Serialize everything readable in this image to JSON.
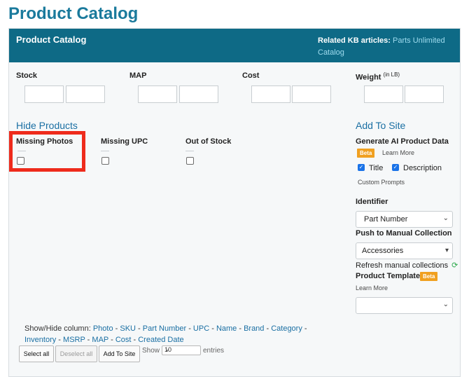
{
  "page_title": "Product Catalog",
  "panel": {
    "title": "Product Catalog",
    "kb_label": "Related KB articles:",
    "kb_link": "Parts Unlimited Catalog"
  },
  "filters": {
    "stock": "Stock",
    "map": "MAP",
    "cost": "Cost",
    "weight": "Weight",
    "weight_unit": "(in LB)"
  },
  "hide_products": {
    "title": "Hide Products",
    "missing_photos": "Missing Photos",
    "missing_upc": "Missing UPC",
    "out_of_stock": "Out of Stock"
  },
  "add_to_site": {
    "title": "Add To Site",
    "generate_ai": "Generate AI Product Data",
    "beta": "Beta",
    "learn_more": "Learn More",
    "title_option": "Title",
    "description_option": "Description",
    "custom_prompts": "Custom Prompts",
    "identifier_label": "Identifier",
    "identifier_value": "Part Number",
    "push_label": "Push to Manual Collection",
    "push_value": "Accessories",
    "refresh_text": "Refresh manual collections",
    "template_label": "Product Template",
    "template_beta": "Beta",
    "template_learn_more": "Learn More",
    "template_value": ""
  },
  "columns": {
    "prefix": "Show/Hide column:",
    "items": [
      "Photo",
      "SKU",
      "Part Number",
      "UPC",
      "Name",
      "Brand",
      "Category",
      "Inventory",
      "MSRP",
      "MAP",
      "Cost",
      "Created Date"
    ]
  },
  "buttons": {
    "select_all": "Select all",
    "deselect_all": "Deselect all",
    "add_to_site": "Add To Site"
  },
  "entries": {
    "show": "Show",
    "value": "10",
    "suffix": "entries"
  },
  "colors": {
    "header": "#0e6a86",
    "title": "#1a7a9c",
    "link": "#1a6fa3",
    "badge": "#f0a020",
    "highlight": "#ee2b1c"
  }
}
